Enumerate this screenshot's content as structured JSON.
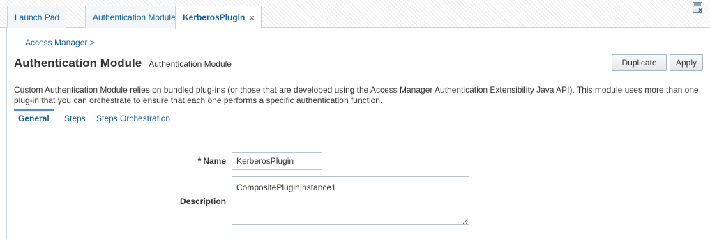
{
  "tabs": [
    {
      "label": "Launch Pad",
      "closable": false,
      "active": false
    },
    {
      "label": "Authentication Modules",
      "closable": true,
      "active": false
    },
    {
      "label": "KerberosPlugin",
      "closable": true,
      "active": true
    }
  ],
  "tab_close_glyph": "×",
  "window_icon": "detach-window-icon",
  "breadcrumb": "Access Manager >",
  "header": {
    "title": "Authentication Module",
    "subtitle": "Authentication Module"
  },
  "buttons": {
    "duplicate": "Duplicate",
    "apply": "Apply"
  },
  "description": "Custom Authentication Module relies on bundled plug-ins (or those that are developed using the Access Manager Authentication Extensibility Java API). This module uses more than one plug-in that you can orchestrate to ensure that each one performs a specific authentication function.",
  "subtabs": [
    {
      "label": "General",
      "active": true
    },
    {
      "label": "Steps",
      "active": false
    },
    {
      "label": "Steps Orchestration",
      "active": false
    }
  ],
  "form": {
    "required_marker": "*",
    "name_label": "Name",
    "name_value": "KerberosPlugin",
    "description_label": "Description",
    "description_value": "CompositePluginInstance1"
  },
  "colors": {
    "link": "#145c9e",
    "active_tab_indicator": "#4d8fd1",
    "border": "#c9d4de"
  }
}
